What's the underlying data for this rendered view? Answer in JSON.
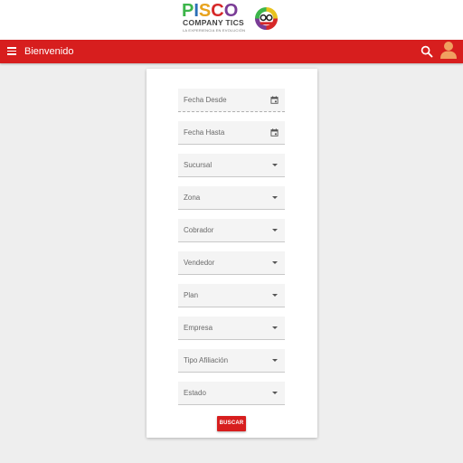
{
  "logo": {
    "letters": [
      {
        "char": "P",
        "color": "#3cb54a"
      },
      {
        "char": "I",
        "color": "#2b6fb6"
      },
      {
        "char": "S",
        "color": "#e8a31e"
      },
      {
        "char": "C",
        "color": "#d62828"
      },
      {
        "char": "O",
        "color": "#7a3c96"
      }
    ],
    "company_line": "COMPANY TICS",
    "tagline": "LA EXPERIENCIA EN EVOLUCIÓN",
    "badge_icon": "colombia-badge-icon"
  },
  "appbar": {
    "title": "Bienvenido",
    "color": "#d71e1e",
    "menu_icon": "menu-icon",
    "search_icon": "search-icon",
    "avatar_icon": "user-avatar-icon",
    "avatar_color": "#f0a060"
  },
  "form": {
    "fields": [
      {
        "label": "Fecha Desde",
        "type": "date",
        "icon": "calendar-icon"
      },
      {
        "label": "Fecha Hasta",
        "type": "date",
        "icon": "calendar-icon"
      },
      {
        "label": "Sucursal",
        "type": "select",
        "icon": "dropdown-caret-icon"
      },
      {
        "label": "Zona",
        "type": "select",
        "icon": "dropdown-caret-icon"
      },
      {
        "label": "Cobrador",
        "type": "select",
        "icon": "dropdown-caret-icon"
      },
      {
        "label": "Vendedor",
        "type": "select",
        "icon": "dropdown-caret-icon"
      },
      {
        "label": "Plan",
        "type": "select",
        "icon": "dropdown-caret-icon"
      },
      {
        "label": "Empresa",
        "type": "select",
        "icon": "dropdown-caret-icon"
      },
      {
        "label": "Tipo Afiliación",
        "type": "select",
        "icon": "dropdown-caret-icon"
      },
      {
        "label": "Estado",
        "type": "select",
        "icon": "dropdown-caret-icon"
      }
    ],
    "submit_label": "BUSCAR"
  }
}
